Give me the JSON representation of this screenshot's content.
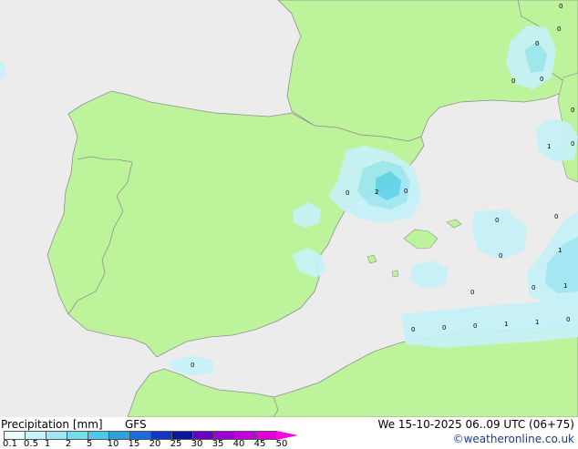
{
  "map": {
    "colors": {
      "sea": "#ececec",
      "land": "#bdf49b",
      "border": "#909090",
      "precip_light": "#c6f2f8",
      "precip_mid": "#9ee6f2",
      "precip_strong": "#5fd3ea"
    },
    "precip_values": [
      "0",
      "0",
      "0",
      "0",
      "0",
      "0",
      "0",
      "0",
      "1",
      "0",
      "0",
      "0",
      "1",
      "0",
      "0",
      "1",
      "0",
      "0",
      "0",
      "0",
      "1",
      "1",
      "0",
      "2",
      "0"
    ]
  },
  "footer": {
    "title": "Precipitation [mm]",
    "model": "GFS",
    "datetime": "We 15-10-2025 06..09 UTC (06+75)",
    "credit": "©weatheronline.co.uk",
    "scale_ticks": [
      "0.1",
      "0.5",
      "1",
      "2",
      "5",
      "10",
      "15",
      "20",
      "25",
      "30",
      "35",
      "40",
      "45",
      "50"
    ],
    "scale_colors": [
      "#e8fcfc",
      "#c6f2f8",
      "#9ee6f2",
      "#75dcee",
      "#4ec8ea",
      "#2ea0e0",
      "#1a6ed8",
      "#1038c0",
      "#0a1896",
      "#6a00c0",
      "#9a00d0",
      "#c000d8",
      "#e000d8",
      "#ff00e0"
    ]
  }
}
